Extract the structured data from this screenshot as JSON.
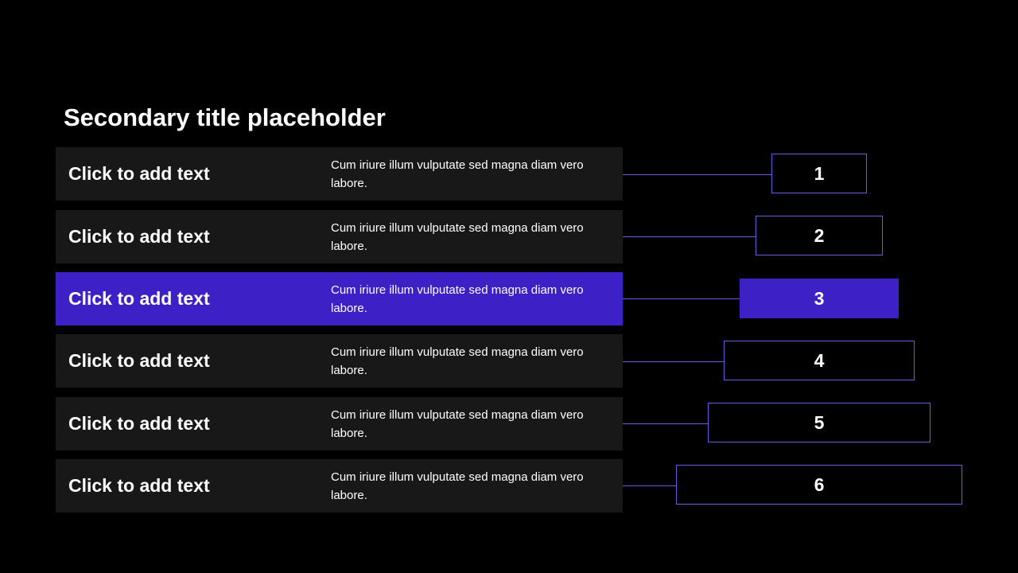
{
  "slide": {
    "title": "Secondary title placeholder"
  },
  "rows": [
    {
      "label": "Click to add text",
      "description": "Cum iriure illum vulputate sed magna diam vero labore.",
      "number": "1"
    },
    {
      "label": "Click to add text",
      "description": "Cum iriure illum vulputate sed magna diam vero labore.",
      "number": "2"
    },
    {
      "label": "Click to add text",
      "description": "Cum iriure illum vulputate sed magna diam vero labore.",
      "number": "3"
    },
    {
      "label": "Click to add text",
      "description": "Cum iriure illum vulputate sed magna diam vero labore.",
      "number": "4"
    },
    {
      "label": "Click to add text",
      "description": "Cum iriure illum vulputate sed magna diam vero labore.",
      "number": "5"
    },
    {
      "label": "Click to add text",
      "description": "Cum iriure illum vulputate sed magna diam vero labore.",
      "number": "6"
    }
  ],
  "colors": {
    "background": "#000000",
    "row": "#181818",
    "accent": "#3d21c6",
    "outline": "#6b5be0",
    "text": "#ffffff"
  }
}
